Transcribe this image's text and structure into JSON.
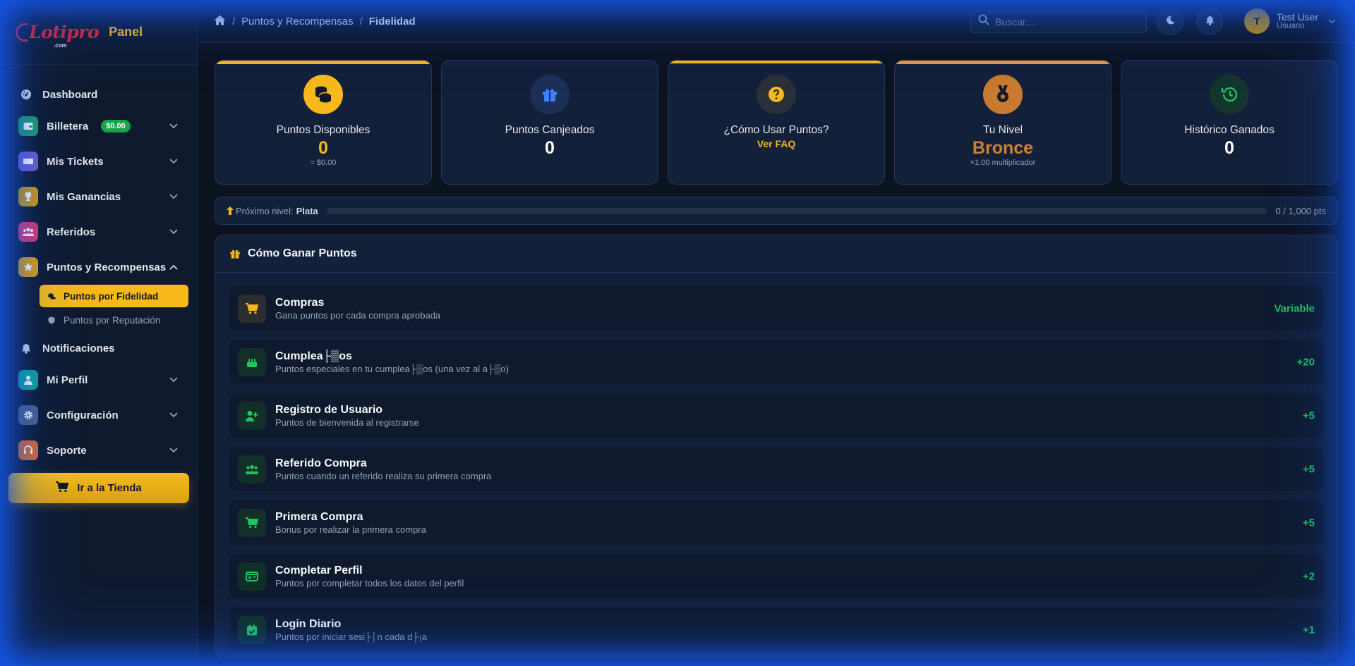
{
  "brand": {
    "logo_text": "Lotipro",
    "logo_domain": ".com",
    "panel_label": "Panel"
  },
  "sidebar": {
    "items": [
      {
        "label": "Dashboard",
        "icon": "dashboard-icon"
      },
      {
        "label": "Billetera",
        "icon": "wallet-icon",
        "badge": "$0.00",
        "color": "#1f9d6b"
      },
      {
        "label": "Mis Tickets",
        "icon": "ticket-icon",
        "color": "#6d5bd0"
      },
      {
        "label": "Mis Ganancias",
        "icon": "trophy-icon",
        "color": "#c99a13"
      },
      {
        "label": "Referidos",
        "icon": "users-icon",
        "color": "#d63a6d"
      },
      {
        "label": "Puntos y Recompensas",
        "icon": "star-icon",
        "color": "#d9a012"
      },
      {
        "label": "Notificaciones",
        "icon": "bell-icon"
      },
      {
        "label": "Mi Perfil",
        "icon": "user-icon",
        "color": "#0fa39a"
      },
      {
        "label": "Configuración",
        "icon": "gear-icon",
        "color": "#4b6184"
      },
      {
        "label": "Soporte",
        "icon": "headset-icon",
        "color": "#d9692a"
      }
    ],
    "sub_items": [
      {
        "label": "Puntos por Fidelidad",
        "icon": "coins-icon"
      },
      {
        "label": "Puntos por Reputación",
        "icon": "shield-icon"
      }
    ],
    "store_button": "Ir a la Tienda"
  },
  "header": {
    "breadcrumb": [
      "Puntos y Recompensas",
      "Fidelidad"
    ],
    "search_placeholder": "Buscar...",
    "user_initial": "T",
    "user_name": "Test User",
    "user_role": "Usuario"
  },
  "stats": [
    {
      "title": "Puntos Disponibles",
      "value": "0",
      "sub": "≈ $0.00",
      "icon": "coins-icon",
      "accent": "#f6b81a"
    },
    {
      "title": "Puntos Canjeados",
      "value": "0",
      "icon": "gift-icon",
      "accent": "#3b82f6"
    },
    {
      "title": "¿Cómo Usar Puntos?",
      "link": "Ver FAQ",
      "icon": "question-icon",
      "accent": "#f6b81a"
    },
    {
      "title": "Tu Nivel",
      "value": "Bronce",
      "sub": "×1.00 multiplicador",
      "icon": "medal-icon",
      "accent": "#cd7f32"
    },
    {
      "title": "Histórico Ganados",
      "value": "0",
      "icon": "history-icon",
      "accent": "#22c55e"
    }
  ],
  "progress": {
    "label": "Próximo nivel:",
    "next_level": "Plata",
    "count": "0 / 1,000 pts",
    "fraction": 0
  },
  "earn": {
    "title": "Cómo Ganar Puntos",
    "rows": [
      {
        "title": "Compras",
        "desc": "Gana puntos por cada compra aprobada",
        "value": "Variable",
        "icon": "cart-icon"
      },
      {
        "title": "Cumplea├▒os",
        "desc": "Puntos especiales en tu cumplea├▒os (una vez al a├▒o)",
        "value": "+20",
        "icon": "cake-icon"
      },
      {
        "title": "Registro de Usuario",
        "desc": "Puntos de bienvenida al registrarse",
        "value": "+5",
        "icon": "user-plus-icon"
      },
      {
        "title": "Referido Compra",
        "desc": "Puntos cuando un referido realiza su primera compra",
        "value": "+5",
        "icon": "users-icon"
      },
      {
        "title": "Primera Compra",
        "desc": "Bonus por realizar la primera compra",
        "value": "+5",
        "icon": "cart-icon"
      },
      {
        "title": "Completar Perfil",
        "desc": "Puntos por completar todos los datos del perfil",
        "value": "+2",
        "icon": "id-card-icon"
      },
      {
        "title": "Login Diario",
        "desc": "Puntos por iniciar sesi├│n cada d├¡a",
        "value": "+1",
        "icon": "calendar-check-icon"
      }
    ]
  }
}
